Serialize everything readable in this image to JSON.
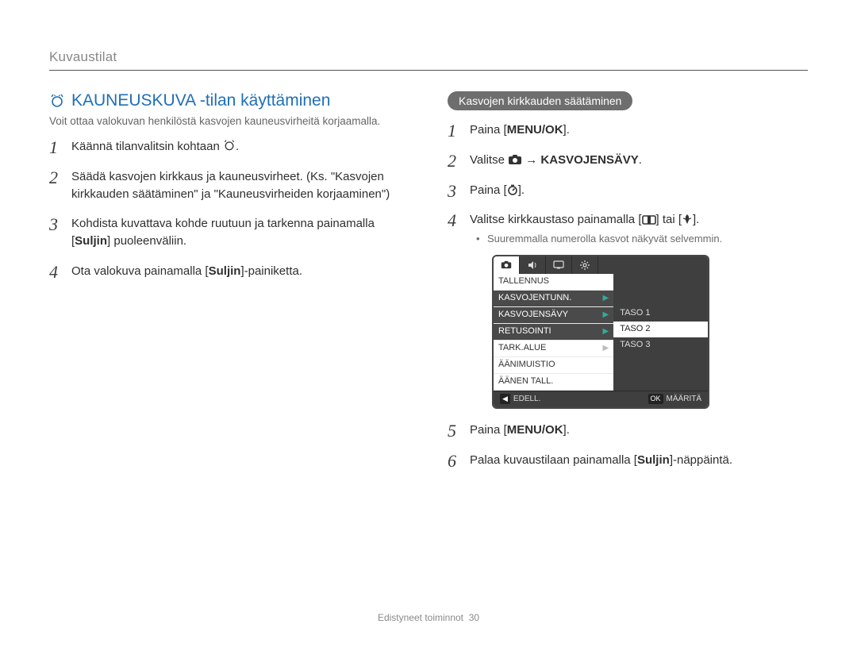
{
  "section_label": "Kuvaustilat",
  "heading": "KAUNEUSKUVA -tilan käyttäminen",
  "intro": "Voit ottaa valokuvan henkilöstä kasvojen kauneusvirheitä korjaamalla.",
  "left_steps": {
    "s1_a": "Käännä tilanvalitsin kohtaan ",
    "s1_b": ".",
    "s2": "Säädä kasvojen kirkkaus ja kauneusvirheet. (Ks. \"Kasvojen kirkkauden säätäminen\" ja \"Kauneusvirheiden korjaaminen\")",
    "s3_a": "Kohdista kuvattava kohde ruutuun ja tarkenna painamalla [",
    "s3_bold": "Suljin",
    "s3_b": "] puoleenväliin.",
    "s4_a": "Ota valokuva painamalla [",
    "s4_bold": "Suljin",
    "s4_b": "]-painiketta."
  },
  "right_pill": "Kasvojen kirkkauden säätäminen",
  "right_steps": {
    "r1_a": "Paina [",
    "r1_bold": "MENU/OK",
    "r1_b": "].",
    "r2_a": "Valitse ",
    "r2_b": " → ",
    "r2_bold": "KASVOJENSÄVY",
    "r2_c": ".",
    "r3_a": "Paina [",
    "r3_b": "].",
    "r4_a": "Valitse kirkkaustaso painamalla [",
    "r4_b": "] tai [",
    "r4_c": "].",
    "r4_note": "Suuremmalla numerolla kasvot näkyvät selvemmin.",
    "r5_a": "Paina [",
    "r5_bold": "MENU/OK",
    "r5_b": "].",
    "r6_a": "Palaa kuvaustilaan painamalla [",
    "r6_bold": "Suljin",
    "r6_b": "]-näppäintä."
  },
  "cam_menu": {
    "left_items": [
      "TALLENNUS",
      "KASVOJENTUNN.",
      "KASVOJENSÄVY",
      "RETUSOINTI",
      "TARK.ALUE",
      "ÄÄNIMUISTIO",
      "ÄÄNEN TALL."
    ],
    "right_items": [
      "TASO 1",
      "TASO 2",
      "TASO 3"
    ],
    "back_label": "EDELL.",
    "ok_symbol": "OK",
    "set_label": "MÄÄRITÄ"
  },
  "footer": {
    "label": "Edistyneet toiminnot",
    "page": "30"
  }
}
